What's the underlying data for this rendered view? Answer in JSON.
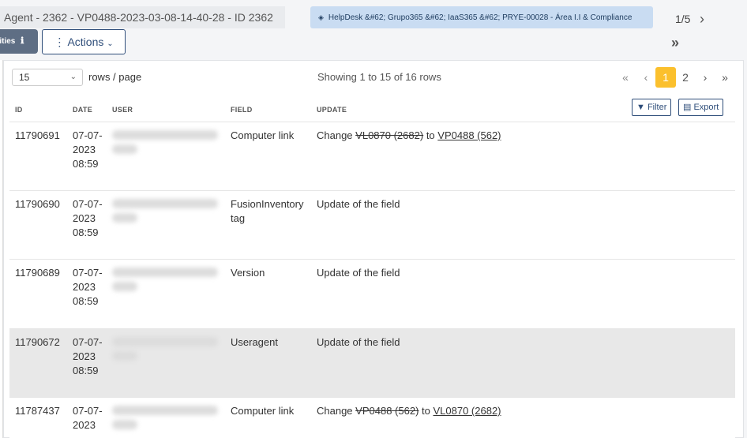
{
  "header": {
    "title": "Agent - 2362 - VP0488-2023-03-08-14-40-28 - ID 2362",
    "entity": "HelpDesk &#62; Grupo365 &#62; IaaS365 &#62; PRYE-00028 - Área I.I & Compliance",
    "position": "1/5"
  },
  "toolbar": {
    "entities_label": "tities",
    "actions_label": "Actions"
  },
  "table_controls": {
    "rows_per_page_value": "15",
    "rows_per_page_label": "rows / page",
    "showing_text": "Showing 1 to 15 of 16 rows",
    "pages": [
      "1",
      "2"
    ],
    "active_page": "1",
    "filter_label": "Filter",
    "export_label": "Export"
  },
  "columns": [
    "ID",
    "DATE",
    "USER",
    "FIELD",
    "UPDATE"
  ],
  "rows": [
    {
      "id": "11790691",
      "date": "07-07-2023 08:59",
      "field": "Computer link",
      "update_prefix": "Change",
      "old_value": "VL0870 (2682)",
      "joiner": "to",
      "new_value": "VP0488 (562)"
    },
    {
      "id": "11790690",
      "date": "07-07-2023 08:59",
      "field": "FusionInventory tag",
      "update_text": "Update of the field"
    },
    {
      "id": "11790689",
      "date": "07-07-2023 08:59",
      "field": "Version",
      "update_text": "Update of the field"
    },
    {
      "id": "11790672",
      "date": "07-07-2023 08:59",
      "field": "Useragent",
      "update_text": "Update of the field"
    },
    {
      "id": "11787437",
      "date": "07-07-2023",
      "field": "Computer link",
      "update_prefix": "Change",
      "old_value": "VP0488 (562)",
      "joiner": "to",
      "new_value": "VL0870 (2682)"
    }
  ]
}
